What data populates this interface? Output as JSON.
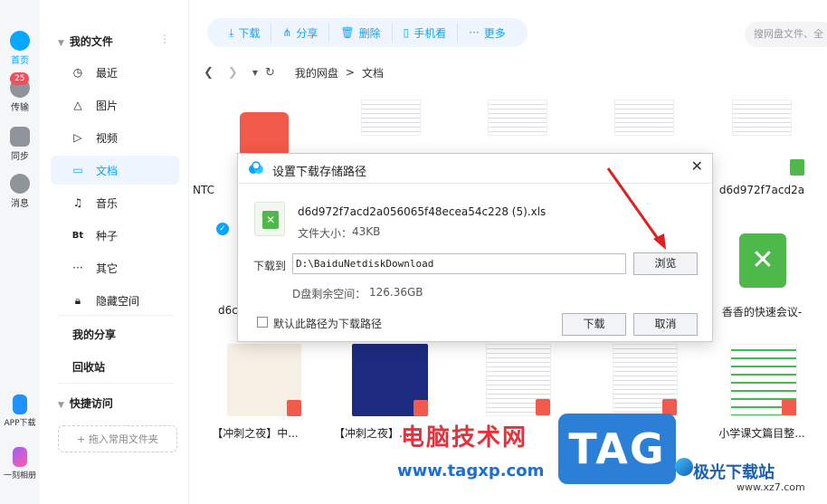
{
  "rail": {
    "items": [
      {
        "label": "首页",
        "icon": "cloud-icon"
      },
      {
        "label": "传输",
        "icon": "transfer-icon",
        "badge": "25"
      },
      {
        "label": "同步",
        "icon": "sync-icon"
      },
      {
        "label": "消息",
        "icon": "message-icon"
      },
      {
        "label": "APP下载",
        "icon": "phone-icon"
      },
      {
        "label": "一刻相册",
        "icon": "album-icon"
      }
    ]
  },
  "sidebar": {
    "my_files": "我的文件",
    "items": [
      {
        "label": "最近",
        "icon": "clock-icon"
      },
      {
        "label": "图片",
        "icon": "mountain-icon"
      },
      {
        "label": "视频",
        "icon": "play-icon"
      },
      {
        "label": "文档",
        "icon": "document-icon",
        "active": true
      },
      {
        "label": "音乐",
        "icon": "headphone-icon"
      },
      {
        "label": "种子",
        "icon": "bt-icon",
        "glyph": "Bt"
      },
      {
        "label": "其它",
        "icon": "more-dots-icon"
      },
      {
        "label": "隐藏空间",
        "icon": "lock-icon"
      }
    ],
    "my_share": "我的分享",
    "recycle_bin": "回收站",
    "quick_access": "快捷访问",
    "add_folder": "+ 拖入常用文件夹"
  },
  "toolbar": {
    "download": "下载",
    "share": "分享",
    "delete": "删除",
    "phone_view": "手机看",
    "more": "更多"
  },
  "search": {
    "placeholder": "搜网盘文件、全"
  },
  "breadcrumb": {
    "root": "我的网盘",
    "sep": ">",
    "current": "文档"
  },
  "files": [
    {
      "name": "NTC",
      "kind": "pdf-icon"
    },
    {
      "name": "",
      "kind": "sheet"
    },
    {
      "name": "",
      "kind": "sheet"
    },
    {
      "name": "",
      "kind": "sheet"
    },
    {
      "name": "d6d972f7acd2a",
      "kind": "sheet"
    },
    {
      "name": "d6c",
      "kind": "xls"
    },
    {
      "name": "香香的快速会议-",
      "kind": "xls"
    },
    {
      "name": "【冲刺之夜】中...",
      "kind": "pdf"
    },
    {
      "name": "【冲刺之夜】...",
      "kind": "pdf"
    },
    {
      "name": "",
      "kind": "pdf"
    },
    {
      "name": "",
      "kind": "pdf"
    },
    {
      "name": "小学课文篇目整...",
      "kind": "pdf"
    }
  ],
  "dialog": {
    "title": "设置下载存储路径",
    "file_name": "d6d972f7acd2a056065f48ecea54c228 (5).xls",
    "file_size_label": "文件大小：",
    "file_size": "43KB",
    "download_to_label": "下载到",
    "path": "D:\\BaiduNetdiskDownload",
    "browse": "浏览",
    "free_space_label": "D盘剩余空间：",
    "free_space": "126.36GB",
    "default_path_label": "默认此路径为下载路径",
    "download": "下载",
    "cancel": "取消"
  },
  "watermark": {
    "title": "电脑技术网",
    "url": "www.tagxp.com",
    "tag": "TAG",
    "jg": "极光下载站",
    "jg_url": "www.xz7.com"
  },
  "colors": {
    "accent": "#06a7ff",
    "xls": "#4fb84a",
    "pdf": "#f25a4b"
  }
}
